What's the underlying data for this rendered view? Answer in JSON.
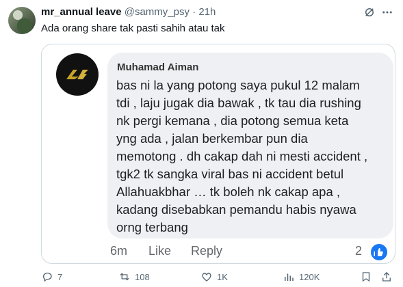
{
  "tweet": {
    "display_name": "mr_annual leave",
    "handle": "@sammy_psy",
    "separator": "·",
    "time": "21h",
    "text": "Ada orang share tak pasti sahih atau tak"
  },
  "fb_post": {
    "author": "Muhamad Aiman",
    "comment_lines": [
      "bas ni la yang potong saya pukul 12 malam",
      "tdi , laju jugak dia bawak , tk tau dia rushing",
      "nk pergi kemana , dia potong semua keta",
      "yng ada , jalan berkembar pun dia",
      "memotong . dh cakap dah ni mesti accident ,",
      "tgk2 tk sangka viral bas ni accident betul",
      "Allahuakbhar … tk boleh nk cakap apa ,",
      "kadang disebabkan pemandu habis nyawa",
      "orng terbang"
    ],
    "time": "6m",
    "like_label": "Like",
    "reply_label": "Reply",
    "reaction_count": "2"
  },
  "footer": {
    "replies": "7",
    "reposts": "108",
    "likes": "1K",
    "views": "120K"
  }
}
